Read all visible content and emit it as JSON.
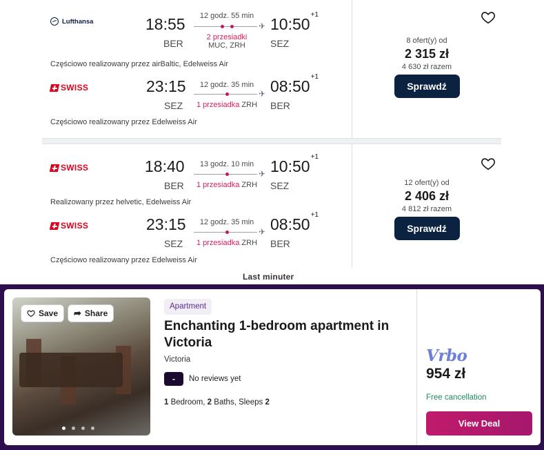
{
  "results": [
    {
      "legs": [
        {
          "airline": "Lufthansa",
          "logo": "lufthansa",
          "dep_time": "18:55",
          "dep_code": "BER",
          "duration": "12 godz. 55 min",
          "stops": "2 przesiadki",
          "via": "MUC, ZRH",
          "arr_time": "10:50",
          "arr_plus": "+1",
          "arr_code": "SEZ",
          "note": "Częściowo realizowany przez airBaltic, Edelweiss Air"
        },
        {
          "airline": "SWISS",
          "logo": "swiss",
          "dep_time": "23:15",
          "dep_code": "SEZ",
          "duration": "12 godz. 35 min",
          "stops": "1 przesiadka",
          "via": "ZRH",
          "arr_time": "08:50",
          "arr_plus": "+1",
          "arr_code": "BER",
          "note": "Częściowo realizowany przez Edelweiss Air"
        }
      ],
      "offers": "8 ofert(y) od",
      "price": "2 315 zł",
      "total": "4 630 zł razem",
      "button": "Sprawdź"
    },
    {
      "legs": [
        {
          "airline": "SWISS",
          "logo": "swiss",
          "dep_time": "18:40",
          "dep_code": "BER",
          "duration": "13 godz. 10 min",
          "stops": "1 przesiadka",
          "via": "ZRH",
          "arr_time": "10:50",
          "arr_plus": "+1",
          "arr_code": "SEZ",
          "note": "Realizowany przez helvetic, Edelweiss Air"
        },
        {
          "airline": "SWISS",
          "logo": "swiss",
          "dep_time": "23:15",
          "dep_code": "SEZ",
          "duration": "12 godz. 35 min",
          "stops": "1 przesiadka",
          "via": "ZRH",
          "arr_time": "08:50",
          "arr_plus": "+1",
          "arr_code": "BER",
          "note": "Częściowo realizowany przez Edelweiss Air"
        }
      ],
      "offers": "12 ofert(y) od",
      "price": "2 406 zł",
      "total": "4 812 zł razem",
      "button": "Sprawdź"
    }
  ],
  "watermark": "Last minuter",
  "ad": {
    "save": "Save",
    "share": "Share",
    "badge": "Apartment",
    "title": "Enchanting 1-bedroom apartment in Victoria",
    "location": "Victoria",
    "rating": "-",
    "rating_text": "No reviews yet",
    "bedrooms": "1",
    "bedrooms_label": "Bedroom,",
    "baths": "2",
    "baths_label": "Baths, Sleeps",
    "sleeps": "2",
    "brand": "Vrbo",
    "price": "954 zł",
    "cancellation": "Free cancellation",
    "cta": "View Deal",
    "carousel_total": 4,
    "carousel_active": 1
  },
  "colors": {
    "accent_pink": "#d81b60",
    "button_navy": "#0b2240",
    "ad_bg": "#2d0f4e",
    "cta": "#c11a6b",
    "vrbo": "#6e7fd9"
  }
}
